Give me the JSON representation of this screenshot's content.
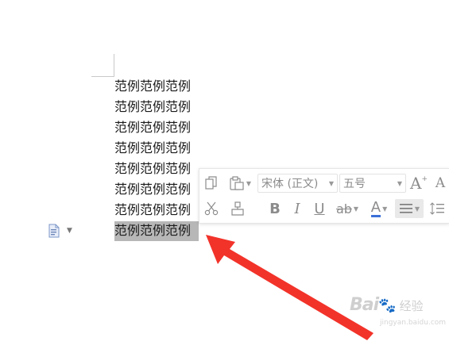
{
  "document": {
    "lines": [
      "范例范例范例",
      "范例范例范例",
      "范例范例范例",
      "范例范例范例",
      "范例范例范例",
      "范例范例范例",
      "范例范例范例",
      "范例范例范例"
    ],
    "selected_line_index": 7
  },
  "mini_toolbar": {
    "font_name": "宋体 (正文)",
    "font_size": "五号",
    "grow_font_label": "A",
    "shrink_font_label": "A",
    "bold_label": "B",
    "italic_label": "I",
    "underline_label": "U",
    "strikethrough_label": "ab",
    "font_color_label": "A",
    "font_color_accent": "#3b6fd8"
  },
  "annotation": {
    "arrow_color": "#f2332a"
  },
  "watermark": {
    "brand": "Bai",
    "cn": "经验",
    "url": "jingyan.baidu.com"
  },
  "icons": [
    "copy-icon",
    "paste-icon",
    "cut-icon",
    "format-painter-icon",
    "align-center-icon",
    "line-spacing-icon",
    "paste-options-icon"
  ]
}
